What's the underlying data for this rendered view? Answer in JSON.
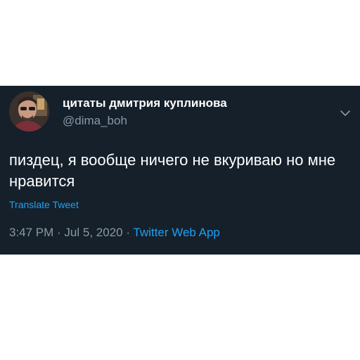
{
  "tweet": {
    "display_name": "цитаты дмитрия куплинова",
    "handle": "@dima_boh",
    "text": "пиздец, я вообще ничего не вкуриваю но мне нравится",
    "translate_label": "Translate Tweet",
    "time": "3:47 PM",
    "separator": " · ",
    "date": "Jul 5, 2020",
    "source": "Twitter Web App",
    "icons": {
      "avatar": "avatar-photo",
      "caret": "chevron-down-icon"
    },
    "colors": {
      "background": "#15202b",
      "primary_text": "#ffffff",
      "secondary_text": "#8899a6",
      "accent": "#1da1f2"
    }
  }
}
